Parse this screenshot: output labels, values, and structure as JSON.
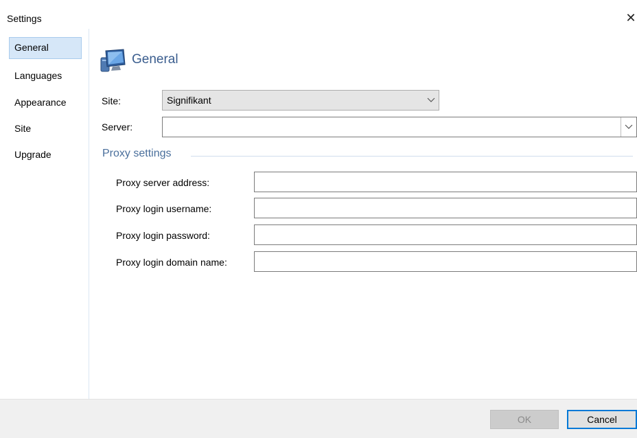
{
  "window": {
    "title": "Settings"
  },
  "nav": {
    "items": [
      {
        "label": "General",
        "selected": true
      },
      {
        "label": "Languages"
      },
      {
        "label": "Appearance"
      },
      {
        "label": "Site"
      },
      {
        "label": "Upgrade"
      }
    ]
  },
  "page": {
    "title": "General",
    "icon": "computer-monitor-icon"
  },
  "site": {
    "label": "Site:",
    "value": "Signifikant"
  },
  "server": {
    "label": "Server:",
    "value": ""
  },
  "proxy": {
    "section_title": "Proxy settings",
    "fields": [
      {
        "label": "Proxy server address:",
        "value": ""
      },
      {
        "label": "Proxy login username:",
        "value": ""
      },
      {
        "label": "Proxy login password:",
        "value": ""
      },
      {
        "label": "Proxy login domain name:",
        "value": ""
      }
    ]
  },
  "footer": {
    "ok_label": "OK",
    "cancel_label": "Cancel"
  },
  "colors": {
    "accent": "#0078d7",
    "heading": "#3a5d8e",
    "selection": "#d6e7f8"
  }
}
